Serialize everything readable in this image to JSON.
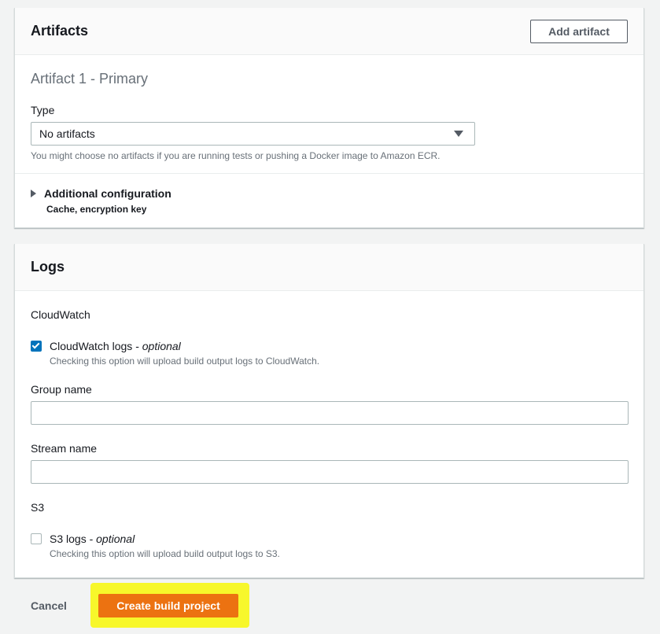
{
  "artifacts": {
    "title": "Artifacts",
    "add_button": "Add artifact",
    "artifact_heading": "Artifact 1 - Primary",
    "type_label": "Type",
    "type_value": "No artifacts",
    "type_hint": "You might choose no artifacts if you are running tests or pushing a Docker image to Amazon ECR.",
    "additional_config_label": "Additional configuration",
    "additional_config_desc": "Cache, encryption key"
  },
  "logs": {
    "title": "Logs",
    "cloudwatch_section": "CloudWatch",
    "cloudwatch_logs": {
      "label": "CloudWatch logs - ",
      "optional": "optional",
      "checked": true,
      "description": "Checking this option will upload build output logs to CloudWatch."
    },
    "group_name_label": "Group name",
    "group_name_value": "",
    "stream_name_label": "Stream name",
    "stream_name_value": "",
    "s3_section": "S3",
    "s3_logs": {
      "label": "S3 logs - ",
      "optional": "optional",
      "checked": false,
      "description": "Checking this option will upload build output logs to S3."
    }
  },
  "footer": {
    "cancel_label": "Cancel",
    "create_label": "Create build project"
  },
  "colors": {
    "primary_button": "#ec7211",
    "checkbox_checked": "#0073bb",
    "highlight": "#f7f72b"
  }
}
